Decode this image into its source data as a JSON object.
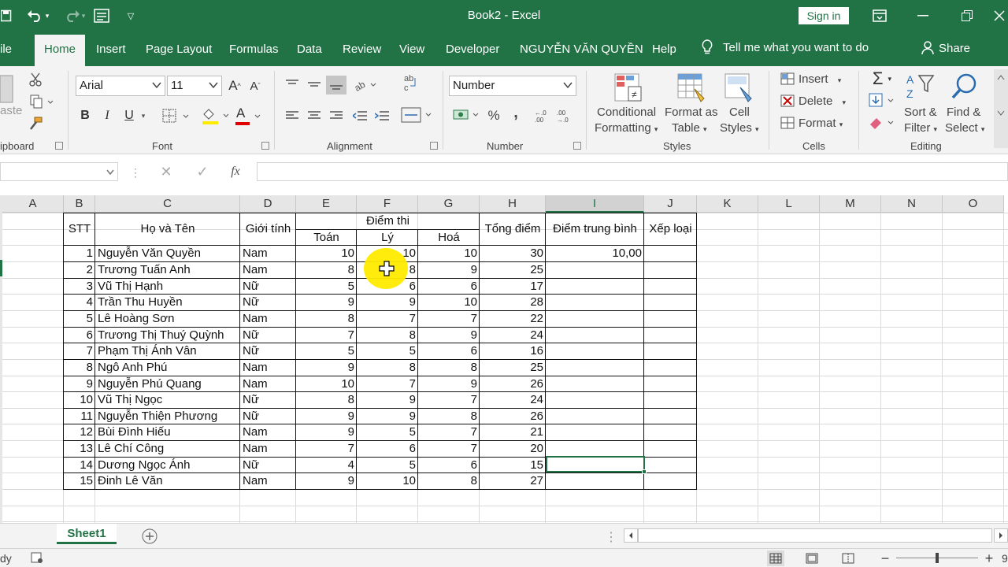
{
  "window": {
    "title": "Book2  -  Excel",
    "sign_in": "Sign in"
  },
  "tabs": [
    "ile",
    "Home",
    "Insert",
    "Page Layout",
    "Formulas",
    "Data",
    "Review",
    "View",
    "Developer",
    "NGUYỄN VĂN QUYỀN",
    "Help"
  ],
  "tell_me": "Tell me what you want to do",
  "share": "Share",
  "ribbon": {
    "clipboard": {
      "label": "ipboard",
      "paste": "aste"
    },
    "font": {
      "label": "Font",
      "name": "Arial",
      "size": "11",
      "bold": "B",
      "italic": "I",
      "underline": "U",
      "font_color_glyph": "A"
    },
    "alignment": {
      "label": "Alignment"
    },
    "number": {
      "label": "Number",
      "format": "Number",
      "percent": "%",
      "comma": ","
    },
    "styles": {
      "label": "Styles",
      "conditional_1": "Conditional",
      "conditional_2": "Formatting",
      "format_table_1": "Format as",
      "format_table_2": "Table",
      "cell_styles_1": "Cell",
      "cell_styles_2": "Styles"
    },
    "cells": {
      "label": "Cells",
      "insert": "Insert",
      "delete": "Delete",
      "format": "Format"
    },
    "editing": {
      "label": "Editing",
      "sort_1": "Sort &",
      "sort_2": "Filter",
      "find_1": "Find &",
      "find_2": "Select"
    }
  },
  "formula_bar": {
    "fx": "fx",
    "cancel": "✕",
    "enter": "✓",
    "value": ""
  },
  "columns": [
    "A",
    "B",
    "C",
    "D",
    "E",
    "F",
    "G",
    "H",
    "I",
    "J",
    "K",
    "L",
    "M",
    "N",
    "O"
  ],
  "selected_column": "I",
  "table": {
    "headers": {
      "stt": "STT",
      "name": "Họ và Tên",
      "gender": "Giới tính",
      "score_group": "Điểm thi",
      "math": "Toán",
      "physics": "Lý",
      "chemistry": "Hoá",
      "total": "Tổng điểm",
      "average": "Điểm trung bình",
      "rank": "Xếp loại"
    },
    "rows": [
      {
        "stt": "1",
        "name": "Nguyễn Văn Quyền",
        "gender": "Nam",
        "math": "10",
        "physics": "10",
        "chemistry": "10",
        "total": "30",
        "average": "10,00",
        "rank": ""
      },
      {
        "stt": "2",
        "name": "Trương Tuấn Anh",
        "gender": "Nam",
        "math": "8",
        "physics": "8",
        "chemistry": "9",
        "total": "25",
        "average": "",
        "rank": ""
      },
      {
        "stt": "3",
        "name": "Vũ Thị Hạnh",
        "gender": "Nữ",
        "math": "5",
        "physics": "6",
        "chemistry": "6",
        "total": "17",
        "average": "",
        "rank": ""
      },
      {
        "stt": "4",
        "name": "Trần Thu Huyền",
        "gender": "Nữ",
        "math": "9",
        "physics": "9",
        "chemistry": "10",
        "total": "28",
        "average": "",
        "rank": ""
      },
      {
        "stt": "5",
        "name": "Lê Hoàng Sơn",
        "gender": "Nam",
        "math": "8",
        "physics": "7",
        "chemistry": "7",
        "total": "22",
        "average": "",
        "rank": ""
      },
      {
        "stt": "6",
        "name": "Trương Thị Thuý Quỳnh",
        "gender": "Nữ",
        "math": "7",
        "physics": "8",
        "chemistry": "9",
        "total": "24",
        "average": "",
        "rank": ""
      },
      {
        "stt": "7",
        "name": "Phạm Thị Ánh Vân",
        "gender": "Nữ",
        "math": "5",
        "physics": "5",
        "chemistry": "6",
        "total": "16",
        "average": "",
        "rank": ""
      },
      {
        "stt": "8",
        "name": "Ngô Anh Phú",
        "gender": "Nam",
        "math": "9",
        "physics": "8",
        "chemistry": "8",
        "total": "25",
        "average": "",
        "rank": ""
      },
      {
        "stt": "9",
        "name": "Nguyễn Phú Quang",
        "gender": "Nam",
        "math": "10",
        "physics": "7",
        "chemistry": "9",
        "total": "26",
        "average": "",
        "rank": ""
      },
      {
        "stt": "10",
        "name": "Vũ Thị Ngọc",
        "gender": "Nữ",
        "math": "8",
        "physics": "9",
        "chemistry": "7",
        "total": "24",
        "average": "",
        "rank": ""
      },
      {
        "stt": "11",
        "name": "Nguyễn Thiện Phương",
        "gender": "Nữ",
        "math": "9",
        "physics": "9",
        "chemistry": "8",
        "total": "26",
        "average": "",
        "rank": ""
      },
      {
        "stt": "12",
        "name": "Bùi Đình Hiếu",
        "gender": "Nam",
        "math": "9",
        "physics": "5",
        "chemistry": "7",
        "total": "21",
        "average": "",
        "rank": ""
      },
      {
        "stt": "13",
        "name": "Lê Chí Công",
        "gender": "Nam",
        "math": "7",
        "physics": "6",
        "chemistry": "7",
        "total": "20",
        "average": "",
        "rank": ""
      },
      {
        "stt": "14",
        "name": "Dương Ngọc Ánh",
        "gender": "Nữ",
        "math": "4",
        "physics": "5",
        "chemistry": "6",
        "total": "15",
        "average": "",
        "rank": ""
      },
      {
        "stt": "15",
        "name": "Đinh Lê Văn",
        "gender": "Nam",
        "math": "9",
        "physics": "10",
        "chemistry": "8",
        "total": "27",
        "average": "",
        "rank": ""
      }
    ]
  },
  "sheet_tabs": [
    "Sheet1"
  ],
  "status": {
    "ready": "dy",
    "zoom_partial": "9"
  },
  "colors": {
    "accent": "#217346",
    "highlight": "#ffeb00"
  }
}
